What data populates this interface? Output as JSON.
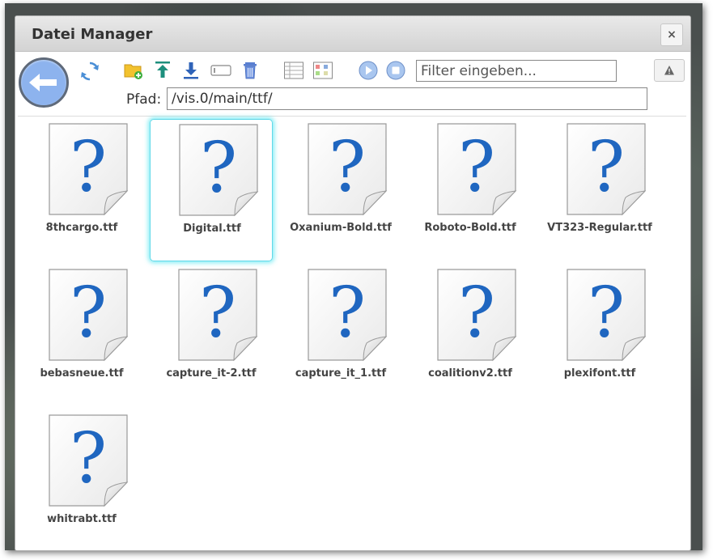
{
  "window": {
    "title": "Datei Manager",
    "close_label": "×"
  },
  "toolbar": {
    "filter_placeholder": "Filter eingeben...",
    "icons": [
      "back-arrow-icon",
      "refresh-icon",
      "new-folder-icon",
      "upload-icon",
      "download-icon",
      "rename-icon",
      "delete-icon",
      "list-view-icon",
      "detail-view-icon",
      "play-icon",
      "stop-icon",
      "warning-icon"
    ]
  },
  "path": {
    "label": "Pfad:",
    "value": "/vis.0/main/ttf/"
  },
  "files": [
    {
      "name": "8thcargo.ttf"
    },
    {
      "name": "Digital.ttf",
      "selected": true
    },
    {
      "name": "Oxanium-Bold.ttf"
    },
    {
      "name": "Roboto-Bold.ttf"
    },
    {
      "name": "VT323-Regular.ttf"
    },
    {
      "name": "bebasneue.ttf"
    },
    {
      "name": "capture_it-2.ttf"
    },
    {
      "name": "capture_it_1.ttf"
    },
    {
      "name": "coalitionv2.ttf"
    },
    {
      "name": "plexifont.ttf"
    },
    {
      "name": "whitrabt.ttf"
    }
  ],
  "colors": {
    "accent_blue": "#8db3ee",
    "selection_glow": "#5fd8e8",
    "question_mark": "#1f66c0"
  }
}
